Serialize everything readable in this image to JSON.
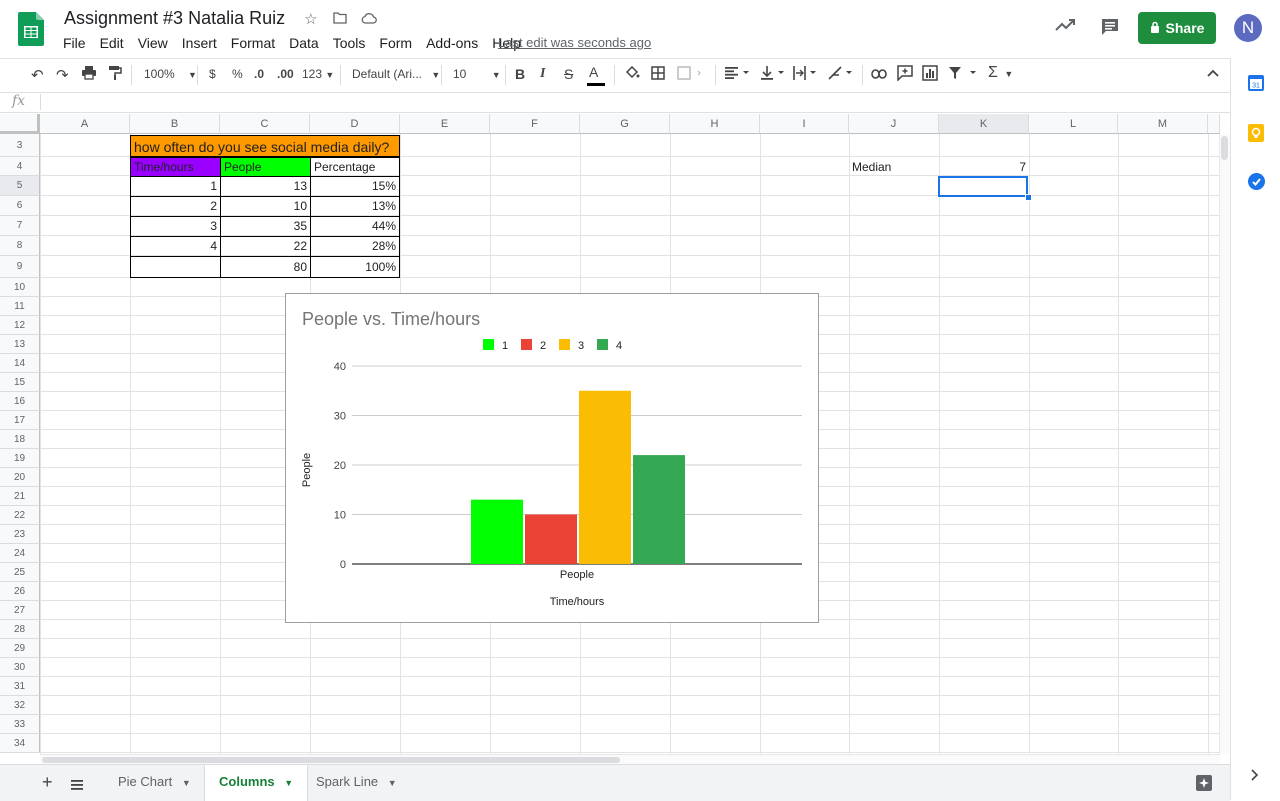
{
  "header": {
    "title": "Assignment #3 Natalia Ruiz",
    "menu": [
      "File",
      "Edit",
      "View",
      "Insert",
      "Format",
      "Data",
      "Tools",
      "Form",
      "Add-ons",
      "Help"
    ],
    "last_edit": "Last edit was seconds ago",
    "share_label": "Share",
    "avatar_letter": "N"
  },
  "toolbar": {
    "zoom": "100%",
    "currency": "$",
    "percent": "%",
    "decimal_less": ".0",
    "decimal_more": ".00",
    "more_formats": "123",
    "font": "Default (Ari...",
    "font_size": "10",
    "bold": "B",
    "italic": "I",
    "strike": "S",
    "text_color": "A"
  },
  "formula_bar": {
    "fx": "fx"
  },
  "grid": {
    "columns": [
      "A",
      "B",
      "C",
      "D",
      "E",
      "F",
      "G",
      "H",
      "I",
      "J",
      "K",
      "L",
      "M"
    ],
    "rows": [
      "3",
      "4",
      "5",
      "6",
      "7",
      "8",
      "9",
      "10",
      "11",
      "12",
      "13",
      "14",
      "15",
      "16",
      "17",
      "18",
      "19",
      "20",
      "21",
      "22",
      "23",
      "24",
      "25",
      "26",
      "27",
      "28",
      "29",
      "30",
      "31",
      "32",
      "33",
      "34"
    ],
    "table": {
      "title": "how often do you see social media daily?",
      "headers": [
        "Time/hours",
        "People",
        "Percentage"
      ],
      "rows": [
        [
          "1",
          "13",
          "15%"
        ],
        [
          "2",
          "10",
          "13%"
        ],
        [
          "3",
          "35",
          "44%"
        ],
        [
          "4",
          "22",
          "28%"
        ],
        [
          "",
          "80",
          "100%"
        ]
      ]
    },
    "median_label": "Median",
    "median_value": "7"
  },
  "chart_data": {
    "type": "bar",
    "title": "People vs. Time/hours",
    "categories": [
      "People"
    ],
    "series": [
      {
        "name": "1",
        "values": [
          13
        ],
        "color": "#00ff00"
      },
      {
        "name": "2",
        "values": [
          10
        ],
        "color": "#ea4335"
      },
      {
        "name": "3",
        "values": [
          35
        ],
        "color": "#fbbc04"
      },
      {
        "name": "4",
        "values": [
          22
        ],
        "color": "#34a853"
      }
    ],
    "xlabel": "Time/hours",
    "ylabel": "People",
    "ylim": [
      0,
      40
    ],
    "yticks": [
      "0",
      "10",
      "20",
      "30",
      "40"
    ],
    "legend": "top",
    "grid": true
  },
  "sheets": {
    "tabs": [
      "Pie Chart",
      "Columns",
      "Spark Line"
    ],
    "active": "Columns"
  },
  "colors": {
    "accent": "#1e8e3e",
    "title_fill": "#ff9900",
    "time_header_fill": "#9900ff",
    "people_header_fill": "#00ff00",
    "selection": "#1a73e8"
  }
}
